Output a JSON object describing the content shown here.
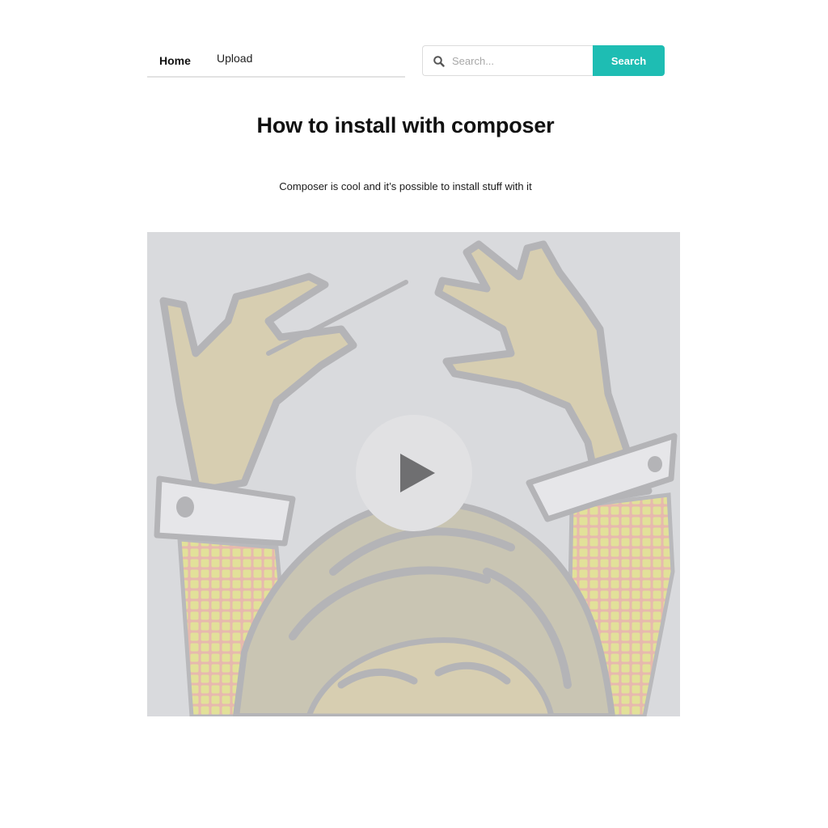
{
  "nav": {
    "items": [
      {
        "label": "Home",
        "active": true
      },
      {
        "label": "Upload",
        "active": false
      }
    ]
  },
  "search": {
    "placeholder": "Search...",
    "button_label": "Search",
    "icon": "search-icon"
  },
  "page": {
    "title": "How to install with composer",
    "description": "Composer is cool and it’s possible to install stuff with it"
  },
  "video": {
    "poster": "composer-conductor-illustration",
    "play_icon": "play-icon"
  },
  "colors": {
    "accent": "#1ebdb3",
    "video_bg": "#d9dadd",
    "play_button_bg": "#e1e1e3",
    "play_icon": "#6f6f71"
  }
}
